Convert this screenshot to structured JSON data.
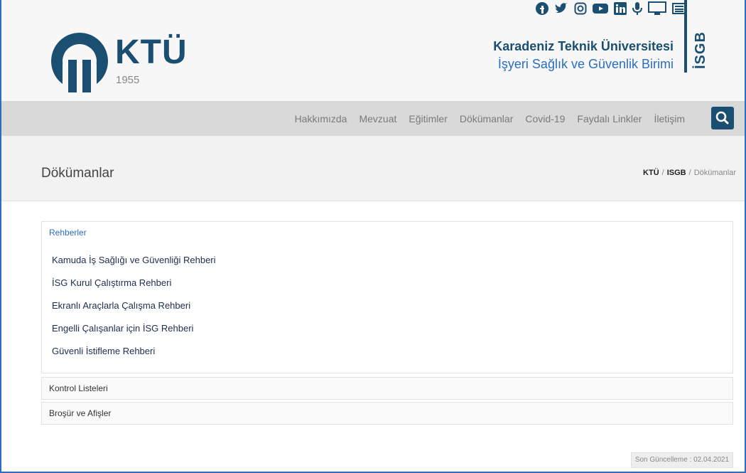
{
  "header": {
    "logo_text": "KTÜ",
    "logo_year": "1955",
    "university": "Karadeniz Teknik Üniversitesi",
    "unit": "İşyeri Sağlık ve Güvenlik Birimi",
    "unit_abbr": "İSGB",
    "social_icons": [
      "facebook-icon",
      "twitter-icon",
      "instagram-icon",
      "youtube-icon",
      "linkedin-icon",
      "podcast-icon",
      "desktop-icon",
      "news-icon"
    ]
  },
  "nav": {
    "items": [
      "Hakkımızda",
      "Mevzuat",
      "Eğitimler",
      "Dökümanlar",
      "Covid-19",
      "Faydalı Linkler",
      "İletişim"
    ]
  },
  "page": {
    "title": "Dökümanlar",
    "breadcrumb": [
      "KTÜ",
      "ISGB",
      "Dökümanlar"
    ]
  },
  "panels": {
    "rehberler": {
      "title": "Rehberler",
      "items": [
        "Kamuda İş Sağlığı ve Güvenliği Rehberi",
        "İSG Kurul Çalıştırma Rehberi",
        "Ekranlı Araçlarla Çalışma Rehberi",
        "Engelli Çalışanlar için İSG Rehberi",
        "Güvenli İstifleme Rehberi"
      ]
    },
    "kontrol": {
      "title": "Kontrol Listeleri"
    },
    "brosur": {
      "title": "Broşür ve Afişler"
    }
  },
  "footer": {
    "updated": "Son Güncelleme : 02.04.2021"
  },
  "colors": {
    "brand": "#1b4f72",
    "accent": "#2a6fbf",
    "nav_bg": "#d9d9d9"
  }
}
